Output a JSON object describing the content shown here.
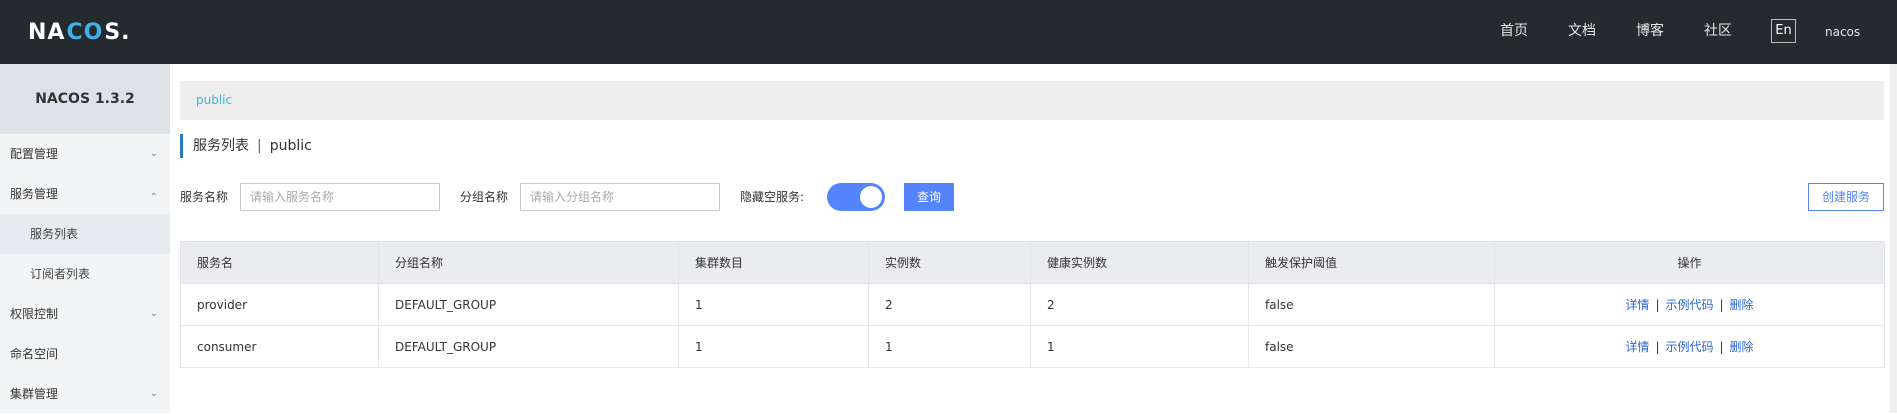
{
  "header": {
    "logo_left": "NA",
    "logo_mid": "CO",
    "logo_right": "S",
    "logo_dot": ".",
    "nav": [
      "首页",
      "文档",
      "博客",
      "社区"
    ],
    "lang": "En",
    "user": "nacos"
  },
  "sidebar": {
    "version": "NACOS 1.3.2",
    "items": [
      {
        "label": "配置管理",
        "chevron": "chevron-down"
      },
      {
        "label": "服务管理",
        "chevron": "chevron-up"
      },
      {
        "label": "服务列表",
        "sub": true,
        "active": true
      },
      {
        "label": "订阅者列表",
        "sub": true
      },
      {
        "label": "权限控制",
        "chevron": "chevron-down"
      },
      {
        "label": "命名空间"
      },
      {
        "label": "集群管理",
        "chevron": "chevron-down"
      }
    ]
  },
  "namespace_bar": {
    "label": "public"
  },
  "title": {
    "main": "服务列表",
    "sep": "|",
    "namespace": "public"
  },
  "filters": {
    "service_name_label": "服务名称",
    "service_name_placeholder": "请输入服务名称",
    "group_name_label": "分组名称",
    "group_name_placeholder": "请输入分组名称",
    "hide_empty_label": "隐藏空服务:",
    "hide_empty_on": true,
    "query_label": "查询",
    "create_label": "创建服务"
  },
  "table": {
    "columns": [
      "服务名",
      "分组名称",
      "集群数目",
      "实例数",
      "健康实例数",
      "触发保护阈值",
      "操作"
    ],
    "rows": [
      [
        "provider",
        "DEFAULT_GROUP",
        "1",
        "2",
        "2",
        "false"
      ],
      [
        "consumer",
        "DEFAULT_GROUP",
        "1",
        "1",
        "1",
        "false"
      ]
    ],
    "ops": {
      "detail": "详情",
      "sample": "示例代码",
      "delete": "删除",
      "sep": "|"
    }
  },
  "colors": {
    "topbar": "#252a2f",
    "accent": "#5584ff",
    "link": "#2a66d5",
    "logo_accent": "#3fb0e8"
  }
}
